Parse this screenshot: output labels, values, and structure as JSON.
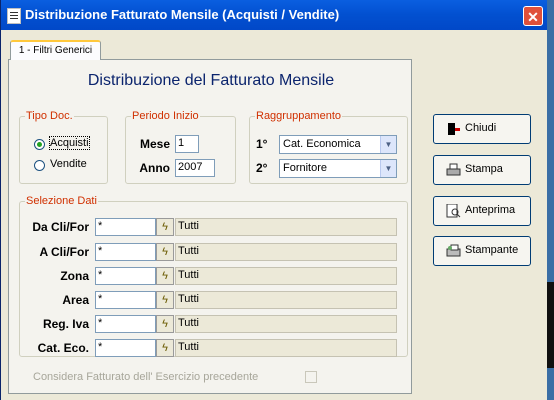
{
  "window": {
    "title": "Distribuzione Fatturato Mensile (Acquisti / Vendite)",
    "close_label": "✕"
  },
  "tab": {
    "label": "1 - Filtri Generici"
  },
  "heading": "Distribuzione del Fatturato Mensile",
  "tipo_doc": {
    "legend": "Tipo Doc.",
    "options": [
      {
        "label": "Acquisti",
        "selected": true
      },
      {
        "label": "Vendite",
        "selected": false
      }
    ]
  },
  "periodo": {
    "legend": "Periodo Inizio",
    "mese_label": "Mese",
    "mese_value": "1",
    "anno_label": "Anno",
    "anno_value": "2007"
  },
  "raggruppamento": {
    "legend": "Raggruppamento",
    "first_label": "1°",
    "first_value": "Cat. Economica",
    "second_label": "2°",
    "second_value": "Fornitore"
  },
  "selezione": {
    "legend": "Selezione Dati",
    "rows": [
      {
        "label": "Da Cli/For",
        "value": "*",
        "desc": "Tutti"
      },
      {
        "label": "A Cli/For",
        "value": "*",
        "desc": "Tutti"
      },
      {
        "label": "Zona",
        "value": "*",
        "desc": "Tutti"
      },
      {
        "label": "Area",
        "value": "*",
        "desc": "Tutti"
      },
      {
        "label": "Reg. Iva",
        "value": "*",
        "desc": "Tutti"
      },
      {
        "label": "Cat. Eco.",
        "value": "*",
        "desc": "Tutti"
      }
    ]
  },
  "considera": {
    "label": "Considera Fatturato dell' Esercizio precedente",
    "checked": false,
    "enabled": false
  },
  "buttons": {
    "chiudi": "Chiudi",
    "stampa": "Stampa",
    "anteprima": "Anteprima",
    "stampante": "Stampante"
  },
  "icons": {
    "app": "form-icon",
    "pick": "lightning-icon",
    "chiudi": "exit-door-icon",
    "stampa": "printer-icon",
    "anteprima": "print-preview-icon",
    "stampante": "printer-setup-icon"
  },
  "colors": {
    "legend": "#d03000",
    "heading": "#0b246d",
    "titlebar": "#0250d0",
    "selected_radio": "#21a121"
  }
}
